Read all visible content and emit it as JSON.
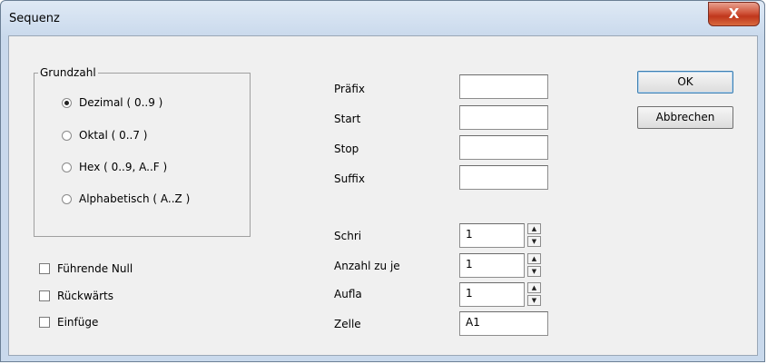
{
  "window": {
    "title": "Sequenz",
    "close_label": "X"
  },
  "group": {
    "legend": "Grundzahl",
    "options": [
      {
        "label": "Dezimal ( 0..9 )",
        "selected": true
      },
      {
        "label": "Oktal ( 0..7 )",
        "selected": false
      },
      {
        "label": "Hex ( 0..9, A..F )",
        "selected": false
      },
      {
        "label": "Alphabetisch ( A..Z )",
        "selected": false
      }
    ]
  },
  "checkboxes": [
    {
      "label": "Führende Null",
      "checked": false
    },
    {
      "label": "Rückwärts",
      "checked": false
    },
    {
      "label": "Einfüge",
      "checked": false
    }
  ],
  "fields": {
    "prefix": {
      "label": "Präfix",
      "value": ""
    },
    "start": {
      "label": "Start",
      "value": ""
    },
    "stop": {
      "label": "Stop",
      "value": ""
    },
    "suffix": {
      "label": "Suffix",
      "value": ""
    },
    "step": {
      "label": "Schri",
      "value": "1"
    },
    "count": {
      "label": "Anzahl zu je",
      "value": "1"
    },
    "repeat": {
      "label": "Aufla",
      "value": "1"
    },
    "cell": {
      "label": "Zelle",
      "value": "A1"
    }
  },
  "spinner": {
    "up": "▲",
    "down": "▼"
  },
  "buttons": {
    "ok": "OK",
    "cancel": "Abbrechen"
  }
}
